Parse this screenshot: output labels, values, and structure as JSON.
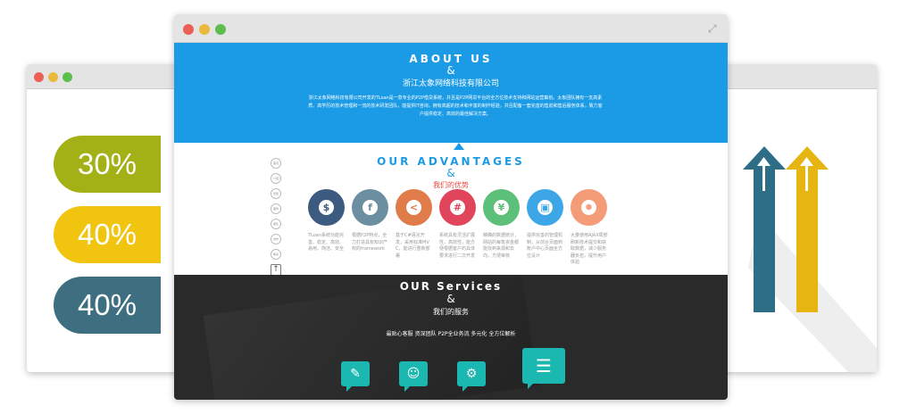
{
  "left_window": {
    "percentages": [
      {
        "label": "30%",
        "color": "#a3b116"
      },
      {
        "label": "40%",
        "color": "#f1c40f"
      },
      {
        "label": "40%",
        "color": "#3d6f80"
      }
    ]
  },
  "right_window": {
    "arrows": [
      {
        "color": "#2e6d86",
        "name": "arrow-up-blue"
      },
      {
        "color": "#e6b512",
        "name": "arrow-up-yellow"
      }
    ]
  },
  "main_window": {
    "about": {
      "title": "ABOUT US",
      "amp": "&",
      "company": "浙江太象网络科技有限公司",
      "body": "浙江太象网络科技有限公司开发的TLoan是一款专业的P2P借贷系统，并且是P2P网贷平台的全方位技术支持和网站运营策划。太象团队拥有一支高素质、高学历的技术管理和一流的技术研发团队，能提供IT咨询，拥有高超的技术和丰富的制作经验，并且配备一套完善的售前和售后服务体系，致力客户提供稳定、高效的最佳解决方案。"
    },
    "advantages": {
      "title": "OUR ADVANTAGES",
      "amp": "&",
      "subtitle": "我们的优势",
      "side_nav": [
        "首页",
        "介绍",
        "优势",
        "服务",
        "团队",
        "合作",
        "联系"
      ],
      "side_up": "↑",
      "features": [
        {
          "color": "#3d5a80",
          "glyph": "$",
          "glyph_color": "#3d5a80",
          "icon": "dollar-icon",
          "text": "TLoan系统功能完善、稳定、高效、易用、简洁、安全"
        },
        {
          "color": "#6b8fa0",
          "glyph": "f",
          "glyph_color": "#6b8fa0",
          "icon": "facebook-icon",
          "text": "根据P2P特点，全力打造具有知识产权的framework"
        },
        {
          "color": "#e07b4a",
          "glyph": "<",
          "glyph_color": "#e07b4a",
          "icon": "share-icon",
          "text": "基于C#语言开发，采用标准MVC，能进行重新部署"
        },
        {
          "color": "#e0455b",
          "glyph": "#",
          "glyph_color": "#e0455b",
          "icon": "tag-icon",
          "text": "系统具有灵活扩展性，高效性，能方便根据客户的具体要求进行二次开发"
        },
        {
          "color": "#5cc07a",
          "glyph": "¥",
          "glyph_color": "#5cc07a",
          "icon": "yen-icon",
          "text": "精确的数据统计，网站的每笔资金都能找到来源和去向，方便审核"
        },
        {
          "color": "#3ca6e6",
          "glyph": "▣",
          "glyph_color": "#3ca6e6",
          "icon": "image-icon",
          "text": "提供完善的管理机制，从前台页面到账户中心页面全方位设计"
        },
        {
          "color": "#f39c77",
          "glyph": "✹",
          "glyph_color": "#f39c77",
          "icon": "sun-icon",
          "text": "大量使用AJAX局部刷新技术提交和获取数据，减少服务器负担，提升用户体验"
        }
      ]
    },
    "services": {
      "title": "OUR Services",
      "amp": "&",
      "subtitle": "我们的服务",
      "tags": "最贴心客服  资深团队  P2P全业务流  多元化  全方位解析",
      "icons": [
        {
          "name": "compass-icon",
          "glyph": "✎"
        },
        {
          "name": "team-icon",
          "glyph": "☺"
        },
        {
          "name": "gear-icon",
          "glyph": "⚙"
        },
        {
          "name": "document-icon",
          "glyph": "☰"
        }
      ]
    }
  }
}
